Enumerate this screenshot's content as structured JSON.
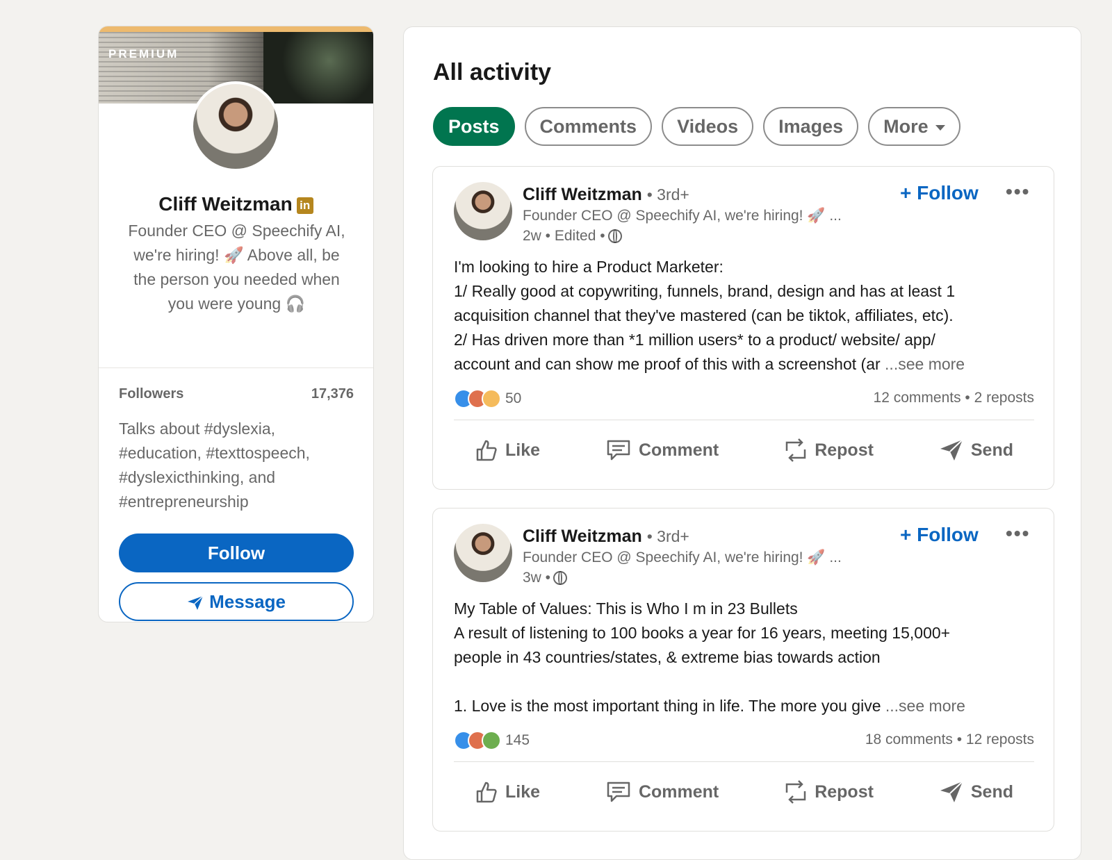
{
  "profile": {
    "premium_label": "PREMIUM",
    "name": "Cliff Weitzman",
    "linkedin_badge": "in",
    "headline": "Founder CEO @ Speechify AI, we're hiring! 🚀 Above all, be the person you needed when you were young 🎧",
    "followers_label": "Followers",
    "followers_count": "17,376",
    "talks_about": "Talks about #dyslexia, #education, #texttospeech, #dyslexicthinking, and #entrepreneurship",
    "follow_label": "Follow",
    "message_label": "Message"
  },
  "activity": {
    "title": "All activity",
    "filters": [
      {
        "label": "Posts",
        "active": true
      },
      {
        "label": "Comments",
        "active": false
      },
      {
        "label": "Videos",
        "active": false
      },
      {
        "label": "Images",
        "active": false
      },
      {
        "label": "More",
        "active": false
      }
    ],
    "posts": [
      {
        "author": "Cliff Weitzman",
        "degree": "• 3rd+",
        "headline": "Founder CEO @ Speechify AI, we're hiring! 🚀 ...",
        "meta": "2w • Edited •",
        "follow_label": "+ Follow",
        "more_label": "•••",
        "lines": [
          "I'm looking to hire a Product Marketer:",
          "1/ Really good at copywriting, funnels, brand, design and has at least 1",
          "acquisition channel that they've mastered (can be tiktok, affiliates, etc).",
          "2/ Has driven more than *1 million users* to a product/ website/ app/",
          "account and can show me proof of this with a screenshot (ar"
        ],
        "see_more": "...see more",
        "reaction_count": "50",
        "stats": "12 comments • 2 reposts",
        "actions": {
          "like": "Like",
          "comment": "Comment",
          "repost": "Repost",
          "send": "Send"
        }
      },
      {
        "author": "Cliff Weitzman",
        "degree": "• 3rd+",
        "headline": "Founder CEO @ Speechify AI, we're hiring! 🚀 ...",
        "meta": "3w •",
        "follow_label": "+ Follow",
        "more_label": "•••",
        "lines": [
          "My Table of Values: This is Who I m in 23 Bullets",
          "A result of listening to 100 books a year for 16 years, meeting 15,000+",
          "people in 43 countries/states, & extreme bias towards action",
          "",
          "1. Love is the most important thing in life. The more you give"
        ],
        "see_more": "...see more",
        "reaction_count": "145",
        "stats": "18 comments • 12 reposts",
        "actions": {
          "like": "Like",
          "comment": "Comment",
          "repost": "Repost",
          "send": "Send"
        }
      }
    ]
  },
  "colors": {
    "page_bg": "#f3f2ef",
    "brand_blue": "#0a66c2",
    "posts_green": "#01754f",
    "premium_gold": "#b5861e"
  },
  "icons": [
    "globe-icon",
    "like-icon",
    "comment-icon",
    "repost-icon",
    "send-icon",
    "caret-down-icon",
    "linkedin-premium-icon",
    "more-dots-icon"
  ]
}
